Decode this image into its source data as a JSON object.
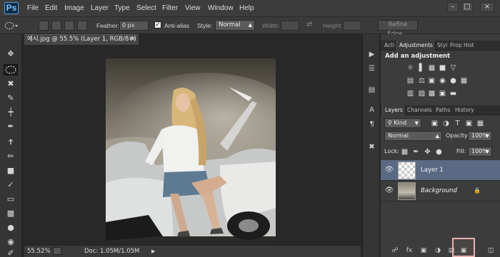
{
  "app": {
    "logo": "Ps"
  },
  "menu": [
    "File",
    "Edit",
    "Image",
    "Layer",
    "Type",
    "Select",
    "Filter",
    "View",
    "Window",
    "Help"
  ],
  "window_controls": {
    "minimize": "–",
    "restore": "□",
    "close": "×"
  },
  "options": {
    "feather_label": "Feather:",
    "feather_value": "0 px",
    "antialias_label": "Anti-alias",
    "antialias_checked": "✓",
    "style_label": "Style:",
    "style_value": "Normal",
    "width_label": "Width:",
    "height_label": "Height:",
    "refine_edge_label": "Refine Edge..."
  },
  "document": {
    "tab_title": "예시.jpg @ 55.5% (Layer 1, RGB/8#) *",
    "tab_close": "×",
    "zoom": "55.52%",
    "doc_info": "Doc: 1.05M/1.05M",
    "status_arrow": "▶"
  },
  "panels": {
    "top_tabs": [
      "Acti",
      "Adjustments",
      "Styl",
      "Prop",
      "Hist"
    ],
    "adjustments_heading": "Add an adjustment",
    "layers_tabs": [
      "Layers",
      "Channels",
      "Paths",
      "History"
    ],
    "kind_label": "Kind",
    "blend_mode": "Normal",
    "opacity_label": "Opacity:",
    "opacity_value": "100%",
    "lock_label": "Lock:",
    "fill_label": "Fill:",
    "fill_value": "100%",
    "layers": [
      {
        "name": "Layer 1",
        "selected": true
      },
      {
        "name": "Background",
        "selected": false
      }
    ]
  },
  "colors": {
    "selected_layer_bg": "#5a6a84",
    "highlight_box": "#e8b3ad",
    "accent_ps": "#5aa0e0"
  },
  "icons": {
    "tools": [
      "move-icon",
      "marquee-icon",
      "lasso-icon",
      "quick-select-icon",
      "crop-icon",
      "eyedropper-icon",
      "healing-icon",
      "brush-icon",
      "stamp-icon",
      "history-brush-icon",
      "eraser-icon",
      "gradient-icon",
      "blur-icon",
      "dodge-icon",
      "pen-icon"
    ]
  }
}
